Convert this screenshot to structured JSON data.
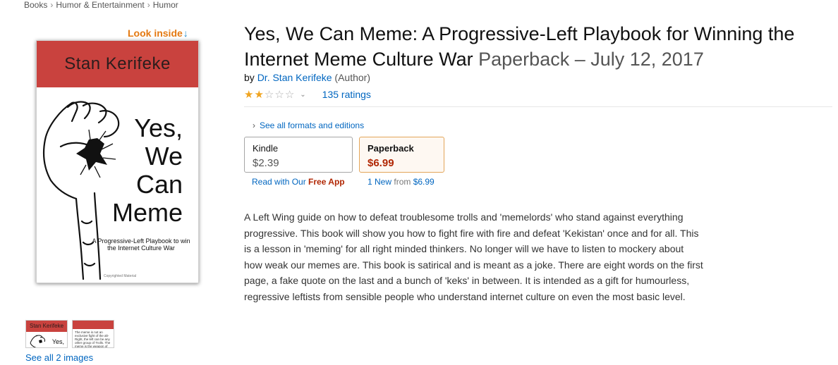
{
  "breadcrumb": [
    "Books",
    "Humor & Entertainment",
    "Humor"
  ],
  "breadcrumb_separator": "›",
  "look_inside": {
    "label": "Look inside",
    "arrow": "↓"
  },
  "cover": {
    "author": "Stan Kerifeke",
    "title_lines": [
      "Yes,",
      "We",
      "Can",
      "Meme"
    ],
    "subtitle": "A Progressive-Left Playbook to win the Internet Culture War",
    "copyright": "Copyrighted Material",
    "band_color": "#c9423e"
  },
  "thumbnails": {
    "thumb1_author": "Stan Kerifeke",
    "thumb1_title": "Yes,",
    "thumb2_text": "The meme is not an exclusive fight of the alt-Right, the left can be any other group of Trolls. The meme is the weapon of these"
  },
  "see_all_images": "See all 2 images",
  "product": {
    "title": "Yes, We Can Meme: A Progressive-Left Playbook for Winning the Internet Meme Culture War",
    "format_date": "Paperback – July 12, 2017",
    "by": "by",
    "author": "Dr. Stan Kerifeke",
    "author_role": "(Author)",
    "rating_stars": 2,
    "rating_max": 5,
    "ratings_count": "135 ratings"
  },
  "formats": {
    "see_all_label": "See all formats and editions",
    "caret": "›",
    "kindle": {
      "name": "Kindle",
      "price": "$2.39",
      "sub_prefix": "Read with Our",
      "sub_highlight": "Free App"
    },
    "paperback": {
      "name": "Paperback",
      "price": "$6.99",
      "sub_new": "1 New",
      "sub_from": "from",
      "sub_price": "$6.99"
    }
  },
  "description": "A Left Wing guide on how to defeat troublesome trolls and 'memelords' who stand against everything progressive. This book will show you how to fight fire with fire and defeat 'Kekistan' once and for all. This is a lesson in 'meming' for all right minded thinkers. No longer will we have to listen to mockery about how weak our memes are. This book is satirical and is meant as a joke. There are eight words on the first page, a fake quote on the last and a bunch of 'keks' in between. It is intended as a gift for humourless, regressive leftists from sensible people who understand internet culture on even the most basic level.",
  "colors": {
    "link": "#0066c0",
    "price": "#b12704",
    "star": "#f0a41f",
    "look_inside": "#e47911"
  }
}
